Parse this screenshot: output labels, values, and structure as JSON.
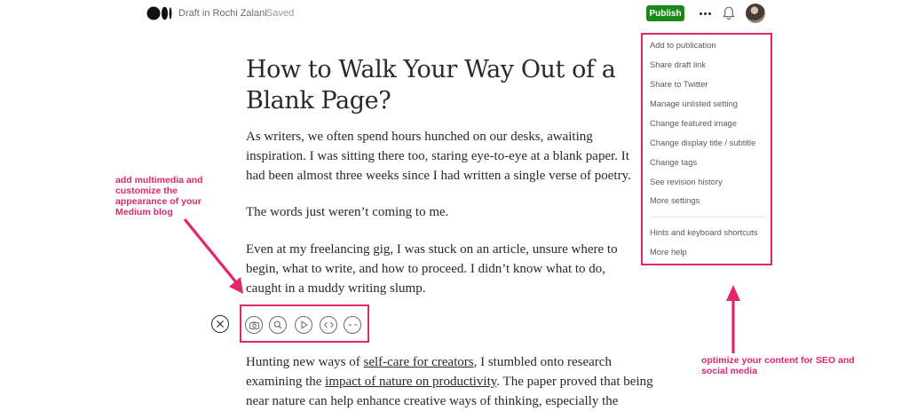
{
  "header": {
    "draft_label": "Draft in Rochi Zalani",
    "saved_label": "Saved",
    "publish_label": "Publish"
  },
  "menu": {
    "items": [
      "Add to publication",
      "Share draft link",
      "Share to Twitter",
      "Manage unlisted setting",
      "Change featured image",
      "Change display title / subtitle",
      "Change tags",
      "See revision history",
      "More settings"
    ],
    "help_items": [
      "Hints and keyboard shortcuts",
      "More help"
    ]
  },
  "article": {
    "title": "How to Walk Your Way Out of a Blank Page?",
    "p1": "As writers, we often spend hours hunched on our desks, awaiting inspiration. I was sitting there too, staring eye-to-eye at a blank paper. It had been almost three weeks since I had written a single verse of poetry.",
    "p2": "The words just weren’t coming to me.",
    "p3": "Even at my freelancing gig, I was stuck on an article, unsure where to begin, what to write, and how to proceed. I didn’t know what to do, caught in a muddy writing slump.",
    "p4_a": "Hunting new ways of ",
    "p4_link1": "self-care for creators",
    "p4_b": ", I stumbled onto research examining the ",
    "p4_link2": "impact of nature on productivity",
    "p4_c": ". The paper proved that being near nature can help enhance creative ways of thinking, especially the"
  },
  "annotations": {
    "left": "add multimedia and customize the appearance of your Medium blog",
    "right": "optimize your content for SEO and social media"
  },
  "colors": {
    "accent": "#e2256c",
    "publish": "#1a8917",
    "text": "#292929"
  },
  "icons": {
    "logo": "medium-logo",
    "more": "more-dots-icon",
    "notifications": "bell-icon",
    "close": "close-icon",
    "image": "camera-icon",
    "unsplash": "search-icon",
    "video": "play-icon",
    "embed": "code-icon",
    "divider": "dash-icon"
  }
}
